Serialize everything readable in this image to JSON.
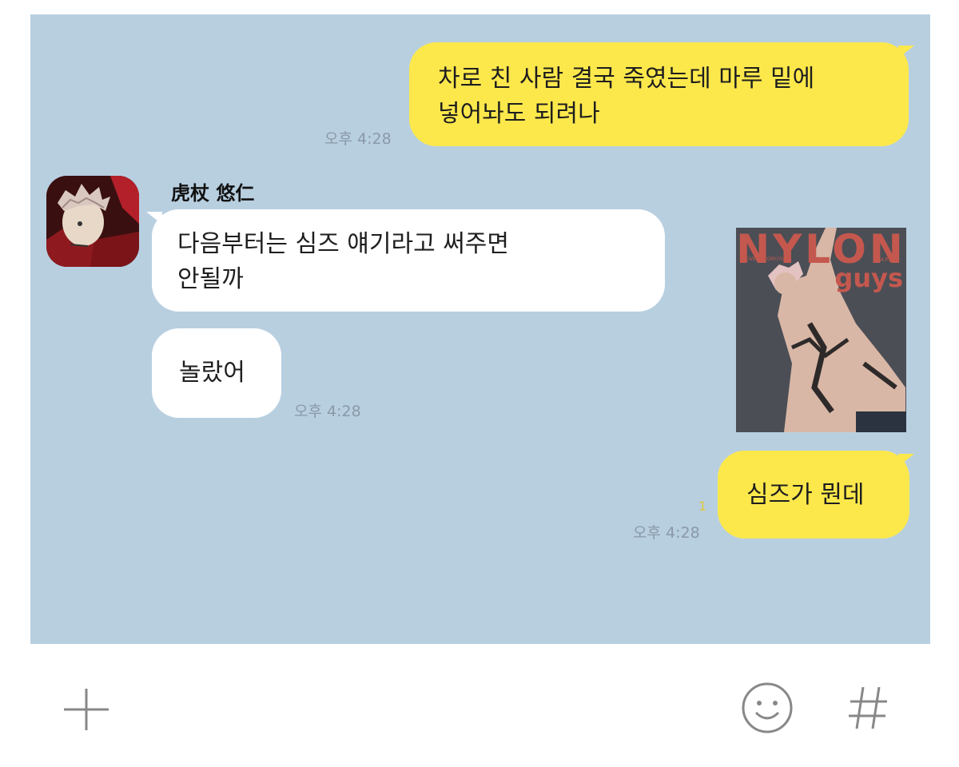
{
  "messages": [
    {
      "side": "me",
      "text_lines": [
        "차로 친 사람 결국 죽였는데 마루 밑에",
        "넣어놔도 되려나"
      ],
      "time": "오후 4:28"
    },
    {
      "side": "other",
      "sender": "虎杖 悠仁",
      "text_lines": [
        "다음부터는 심즈 얘기라고 써주면",
        "안될까"
      ]
    },
    {
      "side": "other",
      "text_lines": [
        "놀랐어"
      ],
      "time": "오후 4:28"
    },
    {
      "side": "me",
      "text_lines": [
        "심즈가 뭔데"
      ],
      "time": "오후 4:28",
      "read_count": "1"
    }
  ],
  "magazine": {
    "title": "NYLON",
    "subtitle": "guys",
    "edition": "JAPAN",
    "cover_text": "COVER STORY/YUJI"
  },
  "input_bar": {
    "plus_icon": "plus-icon",
    "emoji_icon": "smiley-icon",
    "hashtag_icon": "hashtag-icon"
  },
  "colors": {
    "chat_background": "#b8cfe0",
    "my_bubble": "#fde84c",
    "other_bubble": "#ffffff",
    "magazine_accent": "#c4584e"
  }
}
